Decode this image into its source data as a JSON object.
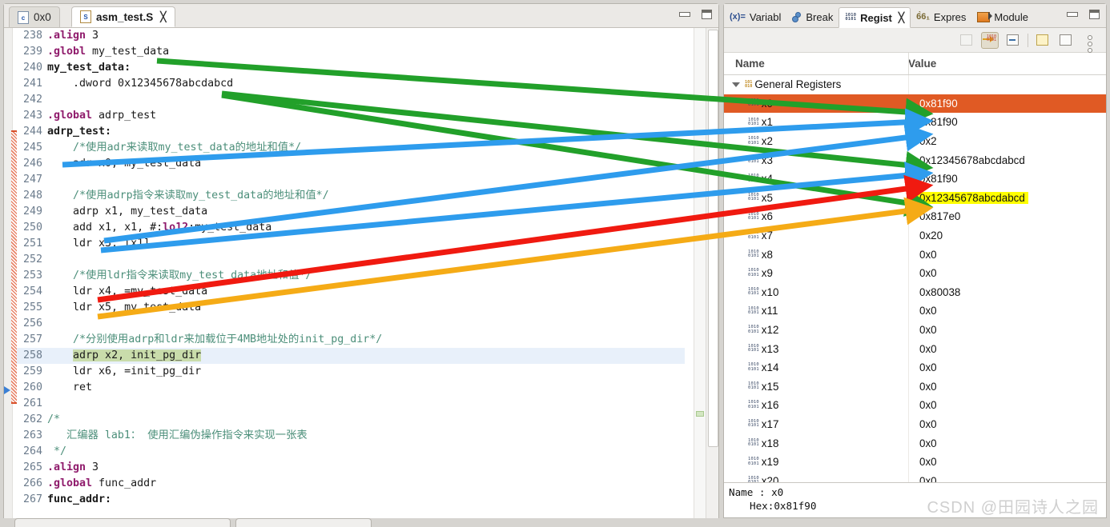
{
  "editor": {
    "tabs": [
      {
        "label": "0x0",
        "icon": "c-file-icon",
        "active": false,
        "closeable": false
      },
      {
        "label": "asm_test.S",
        "icon": "asm-file-icon",
        "active": true,
        "closeable": true
      }
    ],
    "window_buttons": {
      "minimize": "minimize-icon",
      "maximize": "maximize-icon"
    },
    "lines": [
      {
        "no": "238",
        "parts": [
          {
            "t": ".align",
            "c": "dir"
          },
          {
            "t": " 3",
            "c": "txt"
          }
        ]
      },
      {
        "no": "239",
        "parts": [
          {
            "t": ".globl",
            "c": "dir"
          },
          {
            "t": " my_test_data",
            "c": "txt"
          }
        ]
      },
      {
        "no": "240",
        "parts": [
          {
            "t": "my_test_data:",
            "c": "lab"
          }
        ]
      },
      {
        "no": "241",
        "parts": [
          {
            "t": "    .dword 0x12345678abcdabcd",
            "c": "txt"
          }
        ]
      },
      {
        "no": "242",
        "parts": [
          {
            "t": "",
            "c": "txt"
          }
        ]
      },
      {
        "no": "243",
        "parts": [
          {
            "t": ".global",
            "c": "dir"
          },
          {
            "t": " adrp_test",
            "c": "txt"
          }
        ]
      },
      {
        "no": "244",
        "parts": [
          {
            "t": "adrp_test:",
            "c": "lab"
          }
        ]
      },
      {
        "no": "245",
        "parts": [
          {
            "t": "    /*使用adr来读取my_test_data的地址和值*/",
            "c": "cmt"
          }
        ]
      },
      {
        "no": "246",
        "parts": [
          {
            "t": "    adr x0, my_test_data",
            "c": "txt"
          }
        ]
      },
      {
        "no": "247",
        "parts": [
          {
            "t": "",
            "c": "txt"
          }
        ]
      },
      {
        "no": "248",
        "parts": [
          {
            "t": "    /*使用adrp指令来读取my_test_data的地址和值*/",
            "c": "cmt"
          }
        ]
      },
      {
        "no": "249",
        "parts": [
          {
            "t": "    adrp x1, my_test_data",
            "c": "txt"
          }
        ]
      },
      {
        "no": "250",
        "parts": [
          {
            "t": "    add x1, x1, #:",
            "c": "txt"
          },
          {
            "t": "lo12",
            "c": "kw"
          },
          {
            "t": ":my_test_data",
            "c": "txt"
          }
        ]
      },
      {
        "no": "251",
        "parts": [
          {
            "t": "    ldr x3, [x1]",
            "c": "txt"
          }
        ]
      },
      {
        "no": "252",
        "parts": [
          {
            "t": "",
            "c": "txt"
          }
        ]
      },
      {
        "no": "253",
        "parts": [
          {
            "t": "    /*使用ldr指令来读取my_test_data地址和值*/",
            "c": "cmt"
          }
        ]
      },
      {
        "no": "254",
        "parts": [
          {
            "t": "    ldr x4, =my_test_data",
            "c": "txt"
          }
        ]
      },
      {
        "no": "255",
        "parts": [
          {
            "t": "    ldr x5, my_test_data",
            "c": "txt"
          }
        ]
      },
      {
        "no": "256",
        "parts": [
          {
            "t": "",
            "c": "txt"
          }
        ]
      },
      {
        "no": "257",
        "parts": [
          {
            "t": "    /*分别使用adrp和ldr来加载位于4MB地址处的init_pg_dir*/",
            "c": "cmt"
          }
        ]
      },
      {
        "no": "258",
        "parts": [
          {
            "t": "    ",
            "c": "txt"
          },
          {
            "t": "adrp x2, init_pg_dir",
            "c": "sel"
          }
        ],
        "current": true,
        "step_marker": true
      },
      {
        "no": "259",
        "parts": [
          {
            "t": "    ldr x6, =init_pg_dir",
            "c": "txt"
          }
        ]
      },
      {
        "no": "260",
        "parts": [
          {
            "t": "    ret",
            "c": "txt"
          }
        ]
      },
      {
        "no": "261",
        "parts": [
          {
            "t": "",
            "c": "txt"
          }
        ]
      },
      {
        "no": "262",
        "parts": [
          {
            "t": "/*",
            "c": "cmt"
          }
        ]
      },
      {
        "no": "263",
        "parts": [
          {
            "t": "   汇编器 lab1： 使用汇编伪操作指令来实现一张表",
            "c": "cmt"
          }
        ]
      },
      {
        "no": "264",
        "parts": [
          {
            "t": " */",
            "c": "cmt"
          }
        ]
      },
      {
        "no": "265",
        "parts": [
          {
            "t": ".align",
            "c": "dir"
          },
          {
            "t": " 3",
            "c": "txt"
          }
        ]
      },
      {
        "no": "266",
        "parts": [
          {
            "t": ".global",
            "c": "dir"
          },
          {
            "t": " func_addr",
            "c": "txt"
          }
        ]
      },
      {
        "no": "267",
        "parts": [
          {
            "t": "func_addr:",
            "c": "lab"
          }
        ]
      }
    ]
  },
  "registers_view": {
    "tabs": [
      {
        "label": "Variabl",
        "icon": "variables-icon",
        "active": false
      },
      {
        "label": "Break",
        "icon": "breakpoint-icon",
        "active": false
      },
      {
        "label": "Regist",
        "icon": "registers-icon",
        "active": true,
        "closeable": true
      },
      {
        "label": "Expres",
        "icon": "expressions-icon",
        "active": false
      },
      {
        "label": "Module",
        "icon": "modules-icon",
        "active": false
      }
    ],
    "window_buttons": {
      "minimize": "minimize-icon",
      "maximize": "maximize-icon"
    },
    "toolbar": [
      {
        "name": "collapse-all-button",
        "state": "disabled"
      },
      {
        "name": "show-type-names-button",
        "state": "pressed"
      },
      {
        "name": "show-details-pane-button",
        "state": "normal"
      },
      {
        "name": "new-register-group-button",
        "state": "normal"
      },
      {
        "name": "edit-register-group-button",
        "state": "normal"
      },
      {
        "name": "view-menu-button",
        "state": "normal"
      }
    ],
    "columns": {
      "name": "Name",
      "value": "Value"
    },
    "group": {
      "label": "General Registers",
      "expanded": true
    },
    "rows": [
      {
        "name": "x0",
        "value": "0x81f90",
        "selected": true,
        "highlight": false
      },
      {
        "name": "x1",
        "value": "0x81f90",
        "selected": false,
        "highlight": false
      },
      {
        "name": "x2",
        "value": "0x2",
        "selected": false,
        "highlight": false
      },
      {
        "name": "x3",
        "value": "0x12345678abcdabcd",
        "selected": false,
        "highlight": false
      },
      {
        "name": "x4",
        "value": "0x81f90",
        "selected": false,
        "highlight": false
      },
      {
        "name": "x5",
        "value": "0x12345678abcdabcd",
        "selected": false,
        "highlight": true
      },
      {
        "name": "x6",
        "value": "0x817e0",
        "selected": false,
        "highlight": false
      },
      {
        "name": "x7",
        "value": "0x20",
        "selected": false,
        "highlight": false
      },
      {
        "name": "x8",
        "value": "0x0",
        "selected": false,
        "highlight": false
      },
      {
        "name": "x9",
        "value": "0x0",
        "selected": false,
        "highlight": false
      },
      {
        "name": "x10",
        "value": "0x80038",
        "selected": false,
        "highlight": false
      },
      {
        "name": "x11",
        "value": "0x0",
        "selected": false,
        "highlight": false
      },
      {
        "name": "x12",
        "value": "0x0",
        "selected": false,
        "highlight": false
      },
      {
        "name": "x13",
        "value": "0x0",
        "selected": false,
        "highlight": false
      },
      {
        "name": "x14",
        "value": "0x0",
        "selected": false,
        "highlight": false
      },
      {
        "name": "x15",
        "value": "0x0",
        "selected": false,
        "highlight": false
      },
      {
        "name": "x16",
        "value": "0x0",
        "selected": false,
        "highlight": false
      },
      {
        "name": "x17",
        "value": "0x0",
        "selected": false,
        "highlight": false
      },
      {
        "name": "x18",
        "value": "0x0",
        "selected": false,
        "highlight": false
      },
      {
        "name": "x19",
        "value": "0x0",
        "selected": false,
        "highlight": false
      },
      {
        "name": "x20",
        "value": "0x0",
        "selected": false,
        "highlight": false
      }
    ],
    "detail": {
      "line1": "Name : x0",
      "line2": "Hex:0x81f90"
    }
  },
  "watermark": "CSDN @田园诗人之园",
  "annotations": {
    "colors": {
      "green": "#22a02a",
      "blue": "#2e9ced",
      "red": "#f01a10",
      "orange": "#f5ab16",
      "selected_row": "#e05a24",
      "highlight_row": "#ffff00"
    },
    "arrows": [
      {
        "color": "green",
        "from_label": ".globl my_test_data",
        "to_label": "x0 = 0x81f90"
      },
      {
        "color": "green",
        "from_label": ".dword 0x12345678abcdabcd",
        "to_label": "x3 = 0x12345678abcdabcd"
      },
      {
        "color": "green",
        "from_label": ".dword 0x12345678abcdabcd",
        "to_label": "x5 = 0x12345678abcdabcd"
      },
      {
        "color": "blue",
        "from_label": "adr x0, my_test_data",
        "to_label": "x0 = 0x81f90"
      },
      {
        "color": "blue",
        "from_label": "adrp x1 / add x1",
        "to_label": "x1 = 0x81f90"
      },
      {
        "color": "blue",
        "from_label": "ldr x3, [x1]",
        "to_label": "x3 = 0x12345678abcdabcd"
      },
      {
        "color": "red",
        "from_label": "ldr x4, =my_test_data",
        "to_label": "x4 = 0x81f90"
      },
      {
        "color": "orange",
        "from_label": "ldr x5, my_test_data",
        "to_label": "x5 = 0x12345678abcdabcd"
      }
    ]
  }
}
